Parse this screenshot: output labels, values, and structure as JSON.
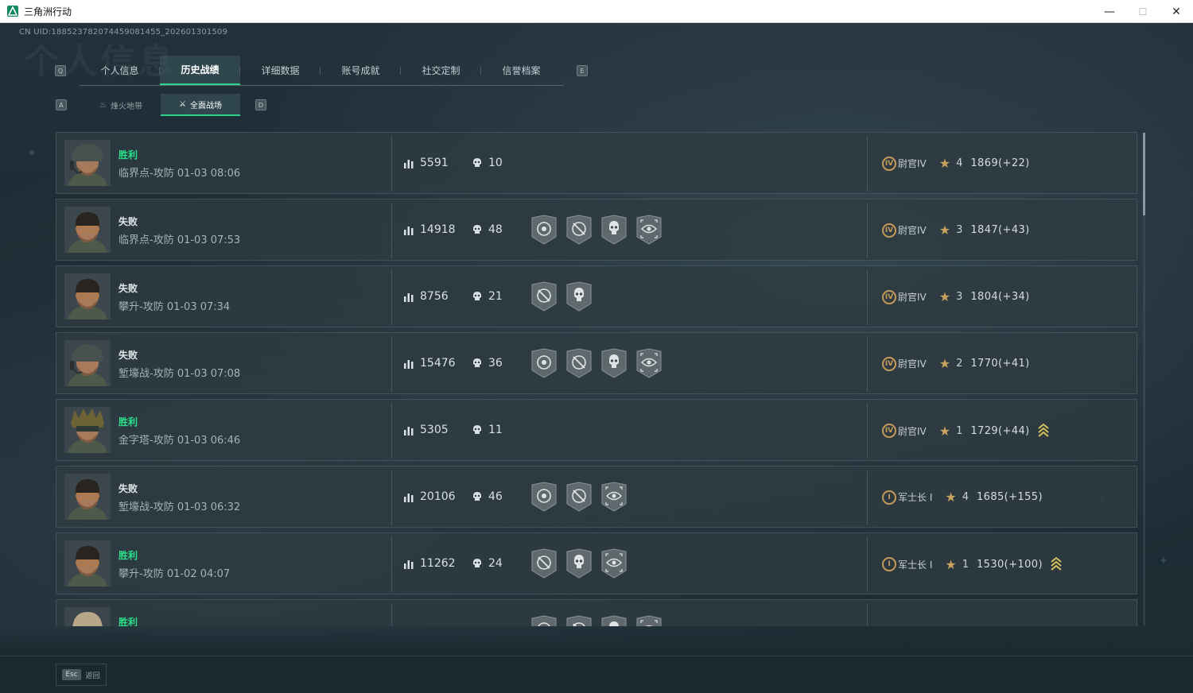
{
  "window": {
    "title": "三角洲行动",
    "controls": {
      "minimize": "—",
      "maximize": "☐",
      "close": "✕"
    }
  },
  "header": {
    "uid": "CN UID:188523782074459081455_202601301509",
    "watermark": "个人信息"
  },
  "tabs": {
    "left_key": "Q",
    "right_key": "E",
    "items": [
      {
        "label": "个人信息",
        "active": false
      },
      {
        "label": "历史战绩",
        "active": true
      },
      {
        "label": "详细数据",
        "active": false
      },
      {
        "label": "账号成就",
        "active": false
      },
      {
        "label": "社交定制",
        "active": false
      },
      {
        "label": "信誉档案",
        "active": false
      }
    ]
  },
  "subtabs": {
    "left_key": "A",
    "right_key": "D",
    "items": [
      {
        "label": "烽火地带",
        "icon": "fire-zone-icon",
        "active": false
      },
      {
        "label": "全面战场",
        "icon": "battlefield-icon",
        "active": true
      }
    ]
  },
  "matches": [
    {
      "result": "胜利",
      "win": true,
      "map": "临界点-攻防 01-03 08:06",
      "score": "5591",
      "kills": "10",
      "badges": [],
      "rank_roman": "IV",
      "rank": "尉官IV",
      "stars": "4",
      "points": "1869(+22)",
      "promo": false,
      "avatar": "helmet"
    },
    {
      "result": "失败",
      "win": false,
      "map": "临界点-攻防 01-03 07:53",
      "score": "14918",
      "kills": "48",
      "badges": [
        "target-badge-icon",
        "crosshair-badge-icon",
        "skull-badge-icon",
        "eye-badge-icon"
      ],
      "rank_roman": "IV",
      "rank": "尉官IV",
      "stars": "3",
      "points": "1847(+43)",
      "promo": false,
      "avatar": "glasses"
    },
    {
      "result": "失败",
      "win": false,
      "map": "攀升-攻防 01-03 07:34",
      "score": "8756",
      "kills": "21",
      "badges": [
        "crosshair-badge-icon",
        "skull-star-badge-icon"
      ],
      "rank_roman": "IV",
      "rank": "尉官IV",
      "stars": "3",
      "points": "1804(+34)",
      "promo": false,
      "avatar": "glasses"
    },
    {
      "result": "失败",
      "win": false,
      "map": "堑壕战-攻防 01-03 07:08",
      "score": "15476",
      "kills": "36",
      "badges": [
        "target-badge-icon",
        "crosshair-badge-icon",
        "skull-badge-icon",
        "eye-badge-icon"
      ],
      "rank_roman": "IV",
      "rank": "尉官IV",
      "stars": "2",
      "points": "1770(+41)",
      "promo": false,
      "avatar": "helmet"
    },
    {
      "result": "胜利",
      "win": true,
      "map": "金字塔-攻防 01-03 06:46",
      "score": "5305",
      "kills": "11",
      "badges": [],
      "rank_roman": "IV",
      "rank": "尉官IV",
      "stars": "1",
      "points": "1729(+44)",
      "promo": true,
      "avatar": "camo"
    },
    {
      "result": "失败",
      "win": false,
      "map": "堑壕战-攻防 01-03 06:32",
      "score": "20106",
      "kills": "46",
      "badges": [
        "target-badge-icon",
        "crosshair-badge-icon",
        "eye-badge-icon"
      ],
      "rank_roman": "I",
      "rank": "军士长 I",
      "stars": "4",
      "points": "1685(+155)",
      "promo": false,
      "avatar": "glasses"
    },
    {
      "result": "胜利",
      "win": true,
      "map": "攀升-攻防 01-02 04:07",
      "score": "11262",
      "kills": "24",
      "badges": [
        "crosshair-badge-icon",
        "skull-star-badge-icon",
        "eye-badge-icon"
      ],
      "rank_roman": "I",
      "rank": "军士长 I",
      "stars": "1",
      "points": "1530(+100)",
      "promo": true,
      "avatar": "glasses"
    },
    {
      "result": "胜利",
      "win": true,
      "map": "",
      "score": "",
      "kills": "",
      "badges": [
        "target-badge-icon",
        "crosshair-badge-icon",
        "skull-badge-icon",
        "eye-badge-icon"
      ],
      "rank_roman": "",
      "rank": "",
      "stars": "",
      "points": "",
      "promo": true,
      "avatar": "hood"
    }
  ],
  "footer": {
    "esc_key": "Esc",
    "back_label": "返回"
  },
  "colors": {
    "accent_green": "#2be08a",
    "rank_gold": "#c79b56",
    "row_bg": "#2e3a42"
  }
}
